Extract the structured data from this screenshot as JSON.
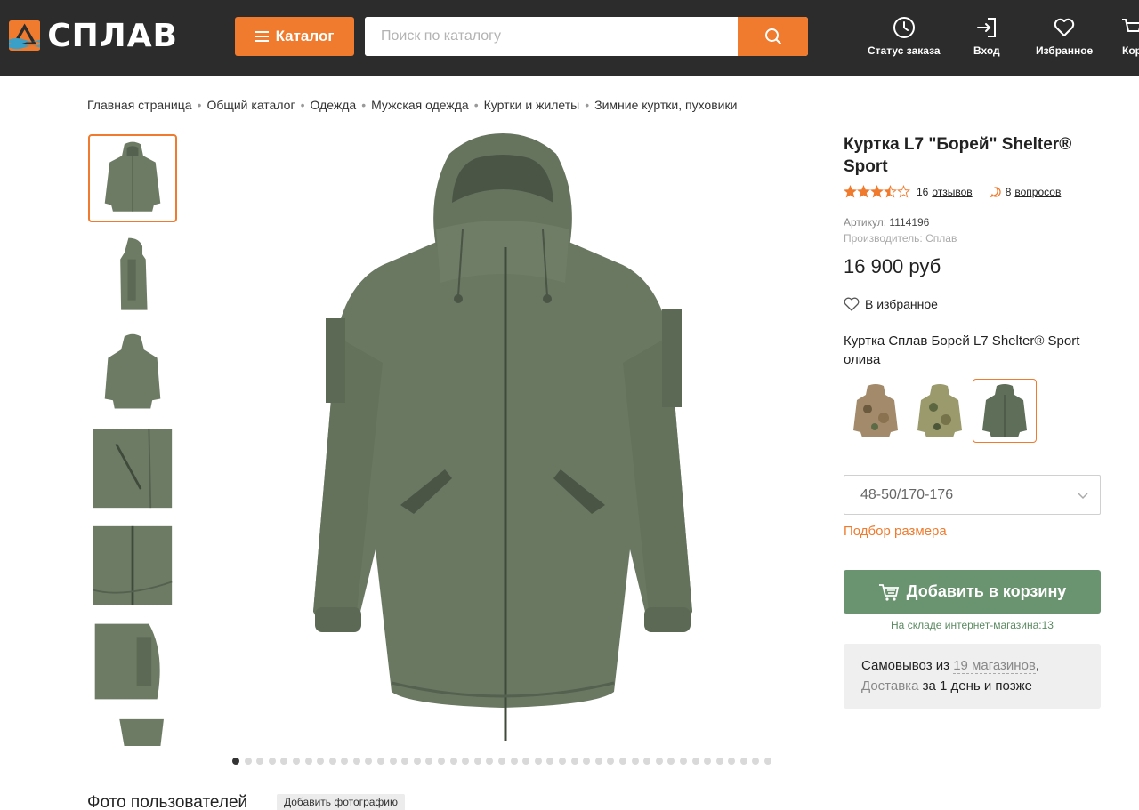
{
  "header": {
    "logo_text": "СПЛАВ",
    "catalog_label": "Каталог",
    "search_placeholder": "Поиск по каталогу",
    "nav": {
      "order_status": "Статус заказа",
      "login": "Вход",
      "favorites": "Избранное",
      "cart_partial": "Кор"
    },
    "colors": {
      "background": "#2c2c2c",
      "accent": "#f07a2d"
    }
  },
  "breadcrumb": [
    "Главная страница",
    "Общий каталог",
    "Одежда",
    "Мужская одежда",
    "Куртки и жилеты",
    "Зимние куртки, пуховики"
  ],
  "gallery": {
    "thumbnails": [
      "front",
      "side",
      "back",
      "pocket-detail",
      "zipper-detail",
      "sleeve-detail",
      "partial"
    ],
    "active_thumbnail": 0,
    "dot_count": 45,
    "active_dot": 0
  },
  "user_photos": {
    "title": "Фото пользователей",
    "add_label": "Добавить фотографию"
  },
  "product": {
    "title": "Куртка L7 \"Борей\" Shelter® Sport",
    "rating": 3.5,
    "rating_max": 5,
    "reviews_count": "16",
    "reviews_label": "отзывов",
    "questions_count": "8",
    "questions_label": "вопросов",
    "article_label": "Артикул:",
    "article": "1114196",
    "manufacturer_label": "Производитель:",
    "manufacturer": "Сплав",
    "price": "16 900 руб",
    "favorite_label": "В избранное",
    "variant_name": "Куртка Сплав Борей L7 Shelter® Sport олива",
    "swatches": [
      "multicam",
      "camo-green",
      "olive"
    ],
    "active_swatch": 2,
    "size_value": "48-50/170-176",
    "size_guide_label": "Подбор размера",
    "add_to_cart_label": "Добавить в корзину",
    "stock_text": "На складе интернет-магазина:13",
    "pickup": {
      "prefix": "Самовывоз из",
      "stores_link": "19 магазинов",
      "comma": ",",
      "delivery_link": "Доставка",
      "delivery_suffix": "за 1 день и позже"
    },
    "colors": {
      "cart_button": "#6a9370",
      "olive": "#5f6e58",
      "star": "#f07a2d"
    }
  }
}
